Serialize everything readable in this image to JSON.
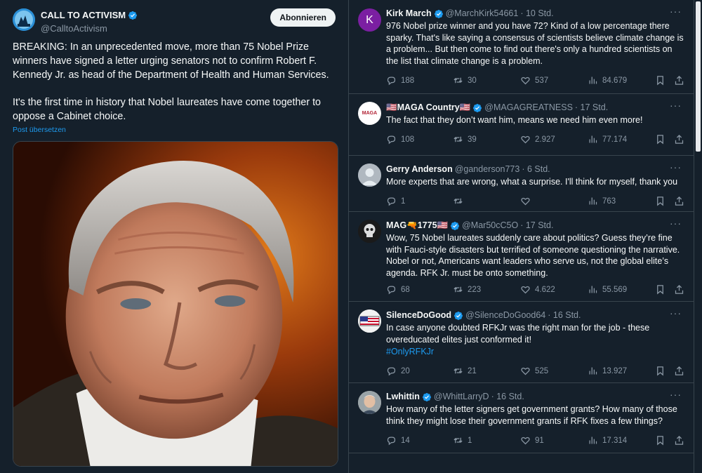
{
  "post": {
    "author_name": "CALL TO ACTIVISM",
    "author_handle": "@CalltoActivism",
    "follow_label": "Abonnieren",
    "text_p1": "BREAKING: In an unprecedented move, more than 75 Nobel Prize winners have signed a letter urging senators not to confirm Robert F. Kennedy Jr. as head of the Department of Health and Human Services.",
    "text_p2": "It's the first time in history that Nobel laureates have come together to oppose a Cabinet choice.",
    "translate_label": "Post übersetzen"
  },
  "replies": [
    {
      "name": "Kirk March",
      "handle": "@MarchKirk54661",
      "time": "· 10 Std.",
      "avatar_letter": "K",
      "text": "976 Nobel prize winner and you have 72? Kind of a low percentage there sparky. That's like saying a consensus of scientists believe climate change is a problem... But then come to find out there's only a hundred scientists on the list that climate change is a problem.",
      "hashtag": "",
      "replies": "188",
      "reposts": "30",
      "likes": "537",
      "views": "84.679"
    },
    {
      "name": "🇺🇸MAGA Country🇺🇸",
      "handle": "@MAGAGREATNESS",
      "time": "· 17 Std.",
      "avatar_letter": "MAGA",
      "text": "The fact that they don’t want him, means we need him even more!",
      "hashtag": "",
      "replies": "108",
      "reposts": "39",
      "likes": "2.927",
      "views": "77.174"
    },
    {
      "name": "Gerry Anderson",
      "handle": "@ganderson773",
      "time": "· 6 Std.",
      "avatar_letter": "",
      "text": "More experts that are wrong, what a surprise.  I'll think for myself, thank you",
      "hashtag": "",
      "replies": "1",
      "reposts": "",
      "likes": "",
      "views": "763"
    },
    {
      "name": "MAG🔫1775🇺🇸",
      "handle": "@Mar50cC5O",
      "time": "· 17 Std.",
      "avatar_letter": "",
      "text": "Wow, 75 Nobel laureates suddenly care about politics? Guess they’re fine with Fauci-style disasters but terrified of someone questioning the narrative. Nobel or not, Americans want leaders who serve us, not the global elite’s agenda. RFK Jr. must be onto something.",
      "hashtag": "",
      "replies": "68",
      "reposts": "223",
      "likes": "4.622",
      "views": "55.569"
    },
    {
      "name": "SilenceDoGood",
      "handle": "@SilenceDoGood64",
      "time": "· 16 Std.",
      "avatar_letter": "",
      "text": "In case anyone doubted RFKJr was the right man for the job - these overeducated elites just conformed it!",
      "hashtag": "#OnlyRFKJr",
      "replies": "20",
      "reposts": "21",
      "likes": "525",
      "views": "13.927"
    },
    {
      "name": "Lwhittin",
      "handle": "@WhittLarryD",
      "time": "· 16 Std.",
      "avatar_letter": "",
      "text": "How many of the letter signers get government grants?  How many of those think they might lose their government grants if RFK fixes a few things?",
      "hashtag": "",
      "replies": "14",
      "reposts": "1",
      "likes": "91",
      "views": "17.314"
    }
  ],
  "colors": {
    "background": "#15202b",
    "border": "#38444d",
    "accent": "#1d9bf0",
    "muted": "#8b98a5",
    "text": "#f7f9f9"
  },
  "icons": [
    "verified-badge-icon",
    "reply-icon",
    "repost-icon",
    "like-icon",
    "views-icon",
    "bookmark-icon",
    "share-icon",
    "more-icon"
  ]
}
